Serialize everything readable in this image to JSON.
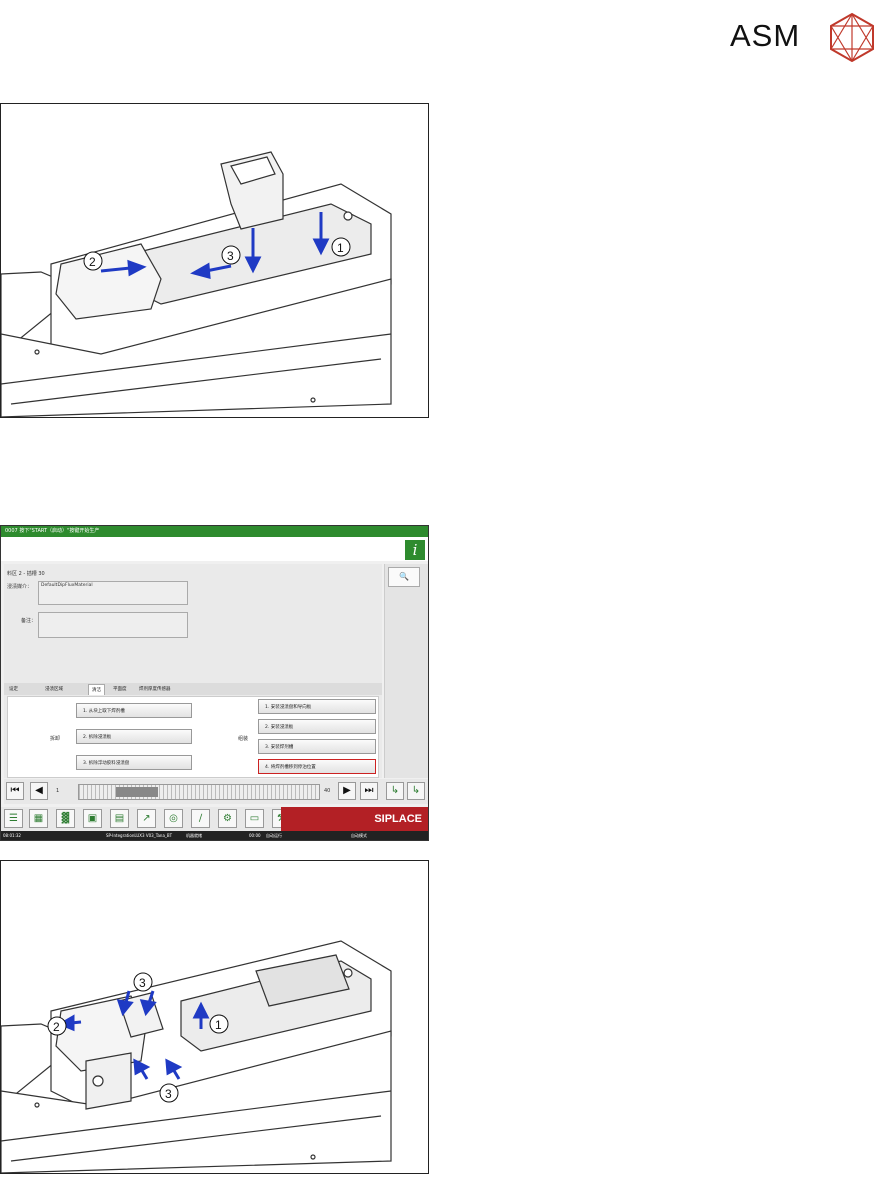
{
  "logo": {
    "text": "ASM"
  },
  "figure1": {
    "callouts": [
      "1",
      "2",
      "3"
    ]
  },
  "screen": {
    "title": "0007 按下\"START（启动）\"按键开始生产",
    "info_icon": "i",
    "location_label": "料区 2 - 插槽 30",
    "material_label": "浸渍媒介：",
    "material_value": "DefaultDipFluxMaterial",
    "note_label": "备注：",
    "tabs": [
      "设定",
      "浸渍区域",
      "清洁",
      "平面度",
      "焊剂厚度传感器"
    ],
    "active_tab": "清洁",
    "remove_label": "拆卸",
    "install_label": "组装",
    "left_steps": [
      "1. 从块上取下焊剂槽",
      "2. 拆除浸渍板",
      "3. 拆除浮动胶料浸渍盘"
    ],
    "right_steps": [
      "1. 安装浸渍盘和导向板",
      "2. 安装浸渍板",
      "3. 安装焊剂槽",
      "4. 将焊剂槽移到停泊位置"
    ],
    "page_start": "1",
    "page_end": "40",
    "brand": "SIPLACE",
    "status": [
      "08:01:32",
      "SP-IntegrationLUX3 V03_Tana_BT",
      "机器就绪",
      "00:00",
      "自动运行",
      "自动模式"
    ]
  },
  "figure3": {
    "callouts": [
      "1",
      "2",
      "3",
      "3"
    ]
  },
  "colors": {
    "arrow": "#1f3ac4",
    "brand_red": "#b32025",
    "title_green": "#2e8b2e"
  }
}
